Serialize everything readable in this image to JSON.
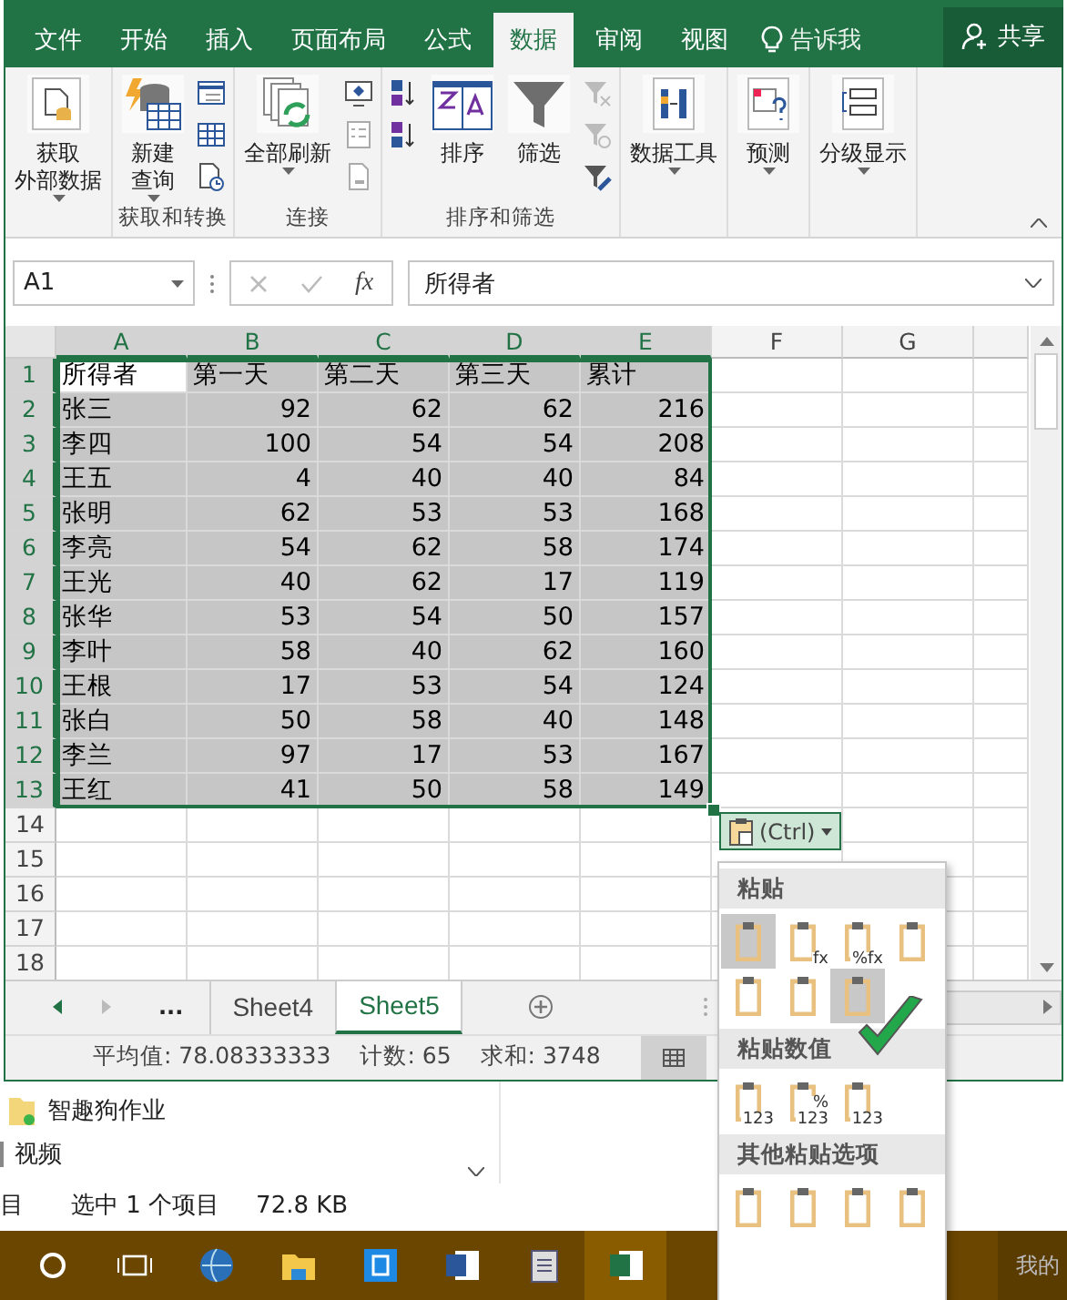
{
  "ribbon_tabs": [
    {
      "label": "文件",
      "selected": false
    },
    {
      "label": "开始",
      "selected": false
    },
    {
      "label": "插入",
      "selected": false
    },
    {
      "label": "页面布局",
      "selected": false
    },
    {
      "label": "公式",
      "selected": false
    },
    {
      "label": "数据",
      "selected": true
    },
    {
      "label": "审阅",
      "selected": false
    },
    {
      "label": "视图",
      "selected": false
    }
  ],
  "tell_me": "告诉我",
  "share_button": "共享",
  "ribbon_groups": [
    {
      "buttons": [
        {
          "lines": [
            "获取",
            "外部数据"
          ],
          "dropdown": true
        }
      ]
    },
    {
      "label": "获取和转换",
      "buttons": [
        {
          "lines": [
            "新建",
            "查询"
          ],
          "dropdown": true
        }
      ]
    },
    {
      "label": "连接",
      "buttons": [
        {
          "lines": [
            "全部刷新"
          ],
          "dropdown": true
        }
      ]
    },
    {
      "label": "排序和筛选",
      "buttons": [
        {
          "lines": [
            "排序"
          ],
          "dropdown": false
        },
        {
          "lines": [
            "筛选"
          ],
          "dropdown": false
        }
      ]
    },
    {
      "buttons": [
        {
          "lines": [
            "数据工具"
          ],
          "dropdown": true
        }
      ]
    },
    {
      "buttons": [
        {
          "lines": [
            "预测"
          ],
          "dropdown": true
        }
      ]
    },
    {
      "buttons": [
        {
          "lines": [
            "分级显示"
          ],
          "dropdown": true
        }
      ]
    }
  ],
  "formula_bar": {
    "name_box": "A1",
    "function_label": "fx",
    "content": "所得者"
  },
  "columns": [
    {
      "label": "A",
      "selected": true
    },
    {
      "label": "B",
      "selected": true
    },
    {
      "label": "C",
      "selected": true
    },
    {
      "label": "D",
      "selected": true
    },
    {
      "label": "E",
      "selected": true
    },
    {
      "label": "F",
      "selected": false
    },
    {
      "label": "G",
      "selected": false
    }
  ],
  "rows": [
    {
      "number": "1",
      "selected": true,
      "cells": [
        "所得者",
        "第一天",
        "第二天",
        "第三天",
        "累计"
      ]
    },
    {
      "number": "2",
      "selected": true,
      "cells": [
        "张三",
        "92",
        "62",
        "62",
        "216"
      ]
    },
    {
      "number": "3",
      "selected": true,
      "cells": [
        "李四",
        "100",
        "54",
        "54",
        "208"
      ]
    },
    {
      "number": "4",
      "selected": true,
      "cells": [
        "王五",
        "4",
        "40",
        "40",
        "84"
      ]
    },
    {
      "number": "5",
      "selected": true,
      "cells": [
        "张明",
        "62",
        "53",
        "53",
        "168"
      ]
    },
    {
      "number": "6",
      "selected": true,
      "cells": [
        "李亮",
        "54",
        "62",
        "58",
        "174"
      ]
    },
    {
      "number": "7",
      "selected": true,
      "cells": [
        "王光",
        "40",
        "62",
        "17",
        "119"
      ]
    },
    {
      "number": "8",
      "selected": true,
      "cells": [
        "张华",
        "53",
        "54",
        "50",
        "157"
      ]
    },
    {
      "number": "9",
      "selected": true,
      "cells": [
        "李叶",
        "58",
        "40",
        "62",
        "160"
      ]
    },
    {
      "number": "10",
      "selected": true,
      "cells": [
        "王根",
        "17",
        "53",
        "54",
        "124"
      ]
    },
    {
      "number": "11",
      "selected": true,
      "cells": [
        "张白",
        "50",
        "58",
        "40",
        "148"
      ]
    },
    {
      "number": "12",
      "selected": true,
      "cells": [
        "李兰",
        "97",
        "17",
        "53",
        "167"
      ]
    },
    {
      "number": "13",
      "selected": true,
      "cells": [
        "王红",
        "41",
        "50",
        "58",
        "149"
      ]
    },
    {
      "number": "14",
      "selected": false,
      "cells": []
    },
    {
      "number": "15",
      "selected": false,
      "cells": []
    },
    {
      "number": "16",
      "selected": false,
      "cells": []
    },
    {
      "number": "17",
      "selected": false,
      "cells": []
    },
    {
      "number": "18",
      "selected": false,
      "cells": []
    }
  ],
  "sheet_tabs": {
    "overflow": "...",
    "tabs": [
      {
        "label": "Sheet4",
        "selected": false
      },
      {
        "label": "Sheet5",
        "selected": true
      }
    ]
  },
  "status_bar": [
    "平均值: 78.08333333",
    "计数: 65",
    "求和: 3748"
  ],
  "paste_options_button": "(Ctrl)",
  "paste_menu": [
    {
      "title": "粘贴",
      "items": [
        {
          "highlighted": true
        },
        {
          "caption": [
            "fx"
          ],
          "highlighted": false
        },
        {
          "caption": [
            "%fx"
          ],
          "highlighted": false
        },
        {
          "highlighted": false
        },
        {
          "highlighted": false
        },
        {
          "highlighted": false
        },
        {
          "highlighted": true
        }
      ]
    },
    {
      "title": "粘贴数值",
      "items": [
        {
          "caption": [
            "123"
          ],
          "highlighted": false
        },
        {
          "caption": [
            "%",
            "123"
          ],
          "highlighted": false
        },
        {
          "caption": [
            "123"
          ],
          "highlighted": false
        }
      ]
    },
    {
      "title": "其他粘贴选项",
      "items": [
        {
          "highlighted": false
        },
        {
          "highlighted": false
        },
        {
          "highlighted": false
        },
        {
          "highlighted": false
        }
      ]
    }
  ],
  "explorer": {
    "items": [
      "智趣狗作业",
      "视频"
    ],
    "status": [
      "目",
      "选中 1 个项目",
      "72.8 KB"
    ]
  },
  "taskbar": {
    "corner_text": "我的"
  }
}
